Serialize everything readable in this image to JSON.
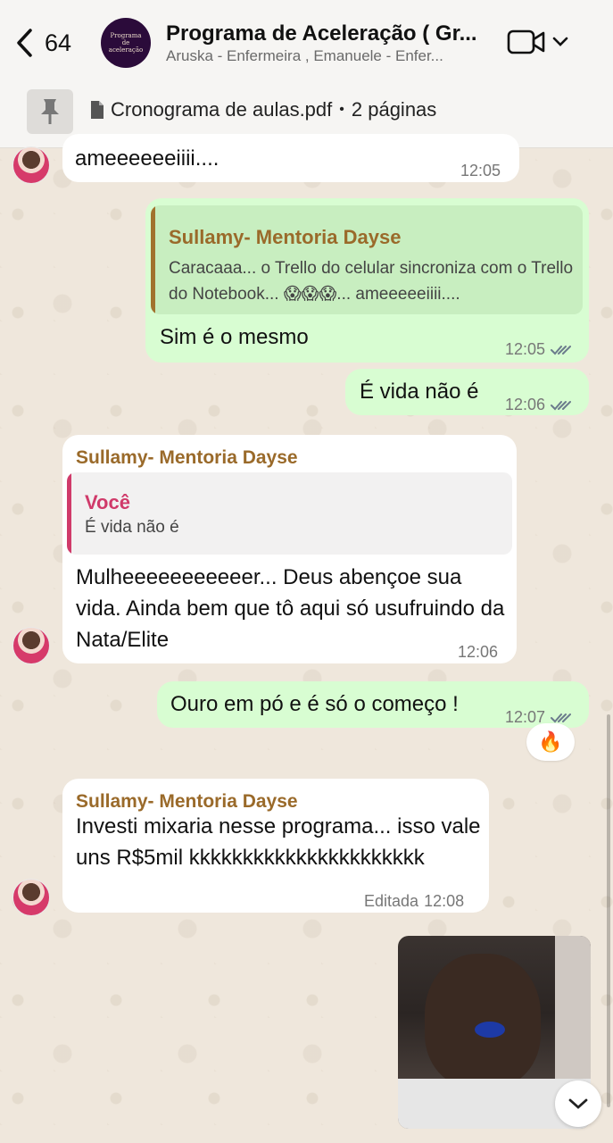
{
  "header": {
    "back_count": "64",
    "avatar_text": "Programa de aceleração",
    "title": "Programa de Aceleração ( Gr...",
    "subtitle": "Aruska - Enfermeira , Emanuele - Enfer..."
  },
  "pinned": {
    "doc_name": "Cronograma de aulas.pdf",
    "separator": "•",
    "pages": "2 páginas"
  },
  "messages": [
    {
      "text": "ameeeeeeiiii....",
      "time": "12:05"
    },
    {
      "quote_name": "Sullamy- Mentoria Dayse",
      "quote_text": "Caracaaa... o Trello do celular sincroniza com o Trello do Notebook... 😱😱😱... ameeeeeiiii....",
      "text": "Sim é o mesmo",
      "time": "12:05"
    },
    {
      "text": "É vida não é",
      "time": "12:06"
    },
    {
      "sender": "Sullamy- Mentoria Dayse",
      "quote_name": "Você",
      "quote_text": "É vida não é",
      "text": "Mulheeeeeeeeeeer... Deus abençoe sua vida. Ainda bem que tô aqui só usufruindo da Nata/Elite",
      "time": "12:06"
    },
    {
      "text": "Ouro em pó e é só o começo !",
      "time": "12:07",
      "reaction": "🔥"
    },
    {
      "sender": "Sullamy- Mentoria Dayse",
      "text": "Investi mixaria nesse programa... isso vale uns R$5mil kkkkkkkkkkkkkkkkkkkkkk",
      "edited": "Editada",
      "time": "12:08"
    }
  ],
  "colors": {
    "outgoing_bubble": "#d8fdd2",
    "incoming_bubble": "#ffffff",
    "sender_name": "#9a6a2a",
    "you_quote": "#d03a6a",
    "read_ticks": "#6b7b8c"
  }
}
